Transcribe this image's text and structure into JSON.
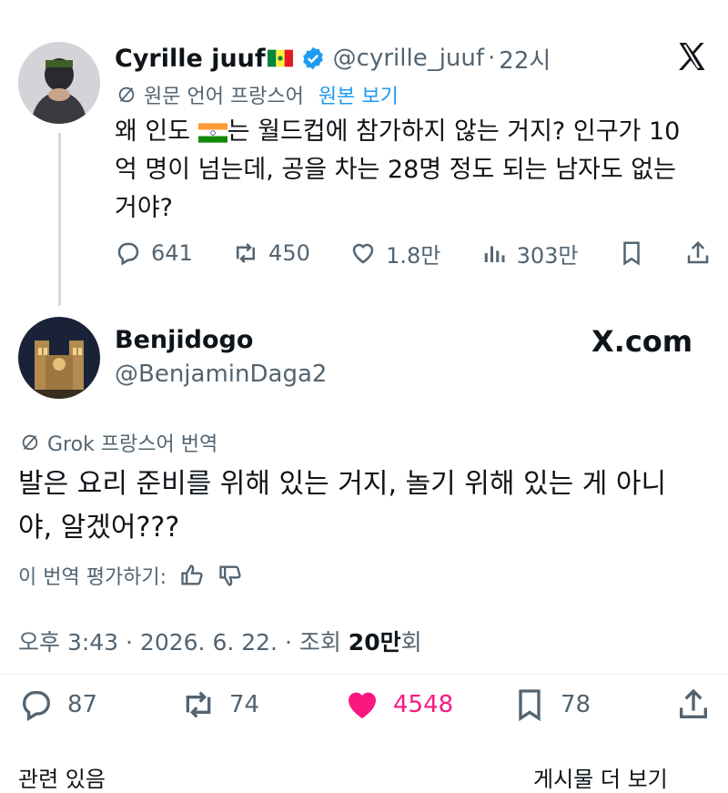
{
  "first_tweet": {
    "author_name": "Cyrille juuf",
    "handle": "@cyrille_juuf",
    "separator": "·",
    "time": "22시",
    "translate_note": "원문 언어 프랑스어",
    "view_original": "원본 보기",
    "text_part1": "왜 인도 ",
    "text_part2": "는 월드컵에 참가하지 않는 거지? 인구가 10",
    "text_line2": "억 명이 넘는데, 공을 차는 28명 정도 되는 남자도 없는",
    "text_line3": "거야?",
    "replies": "641",
    "retweets": "450",
    "likes": "1.8만",
    "views": "303만"
  },
  "second_tweet": {
    "author_name": "Benjidogo",
    "handle": "@BenjaminDaga2",
    "watermark": "X.com",
    "translate_note": "Grok 프랑스어 번역",
    "text_line1": "발은 요리 준비를 위해 있는 거지, 놀기 위해 있는 게 아니",
    "text_line2": "야, 알겠어???",
    "rate_translation": "이 번역 평가하기:",
    "timestamp": "오후 3:43 · 2026. 6. 22. · 조회 ",
    "views_bold": "20만",
    "views_suffix": "회",
    "replies": "87",
    "retweets": "74",
    "likes": "4548",
    "bookmarks": "78"
  },
  "bottom_cut_left": "관련 있음",
  "bottom_cut_right": "게시물 더 보기",
  "colors": {
    "like_pink": "#f91880",
    "verified_blue": "#1d9bf0",
    "text_gray": "#536471"
  },
  "icons": [
    "reply-icon",
    "retweet-icon",
    "like-icon",
    "views-icon",
    "bookmark-icon",
    "share-icon",
    "x-logo-icon",
    "verified-icon",
    "translate-icon",
    "thumbs-up-icon",
    "thumbs-down-icon"
  ]
}
